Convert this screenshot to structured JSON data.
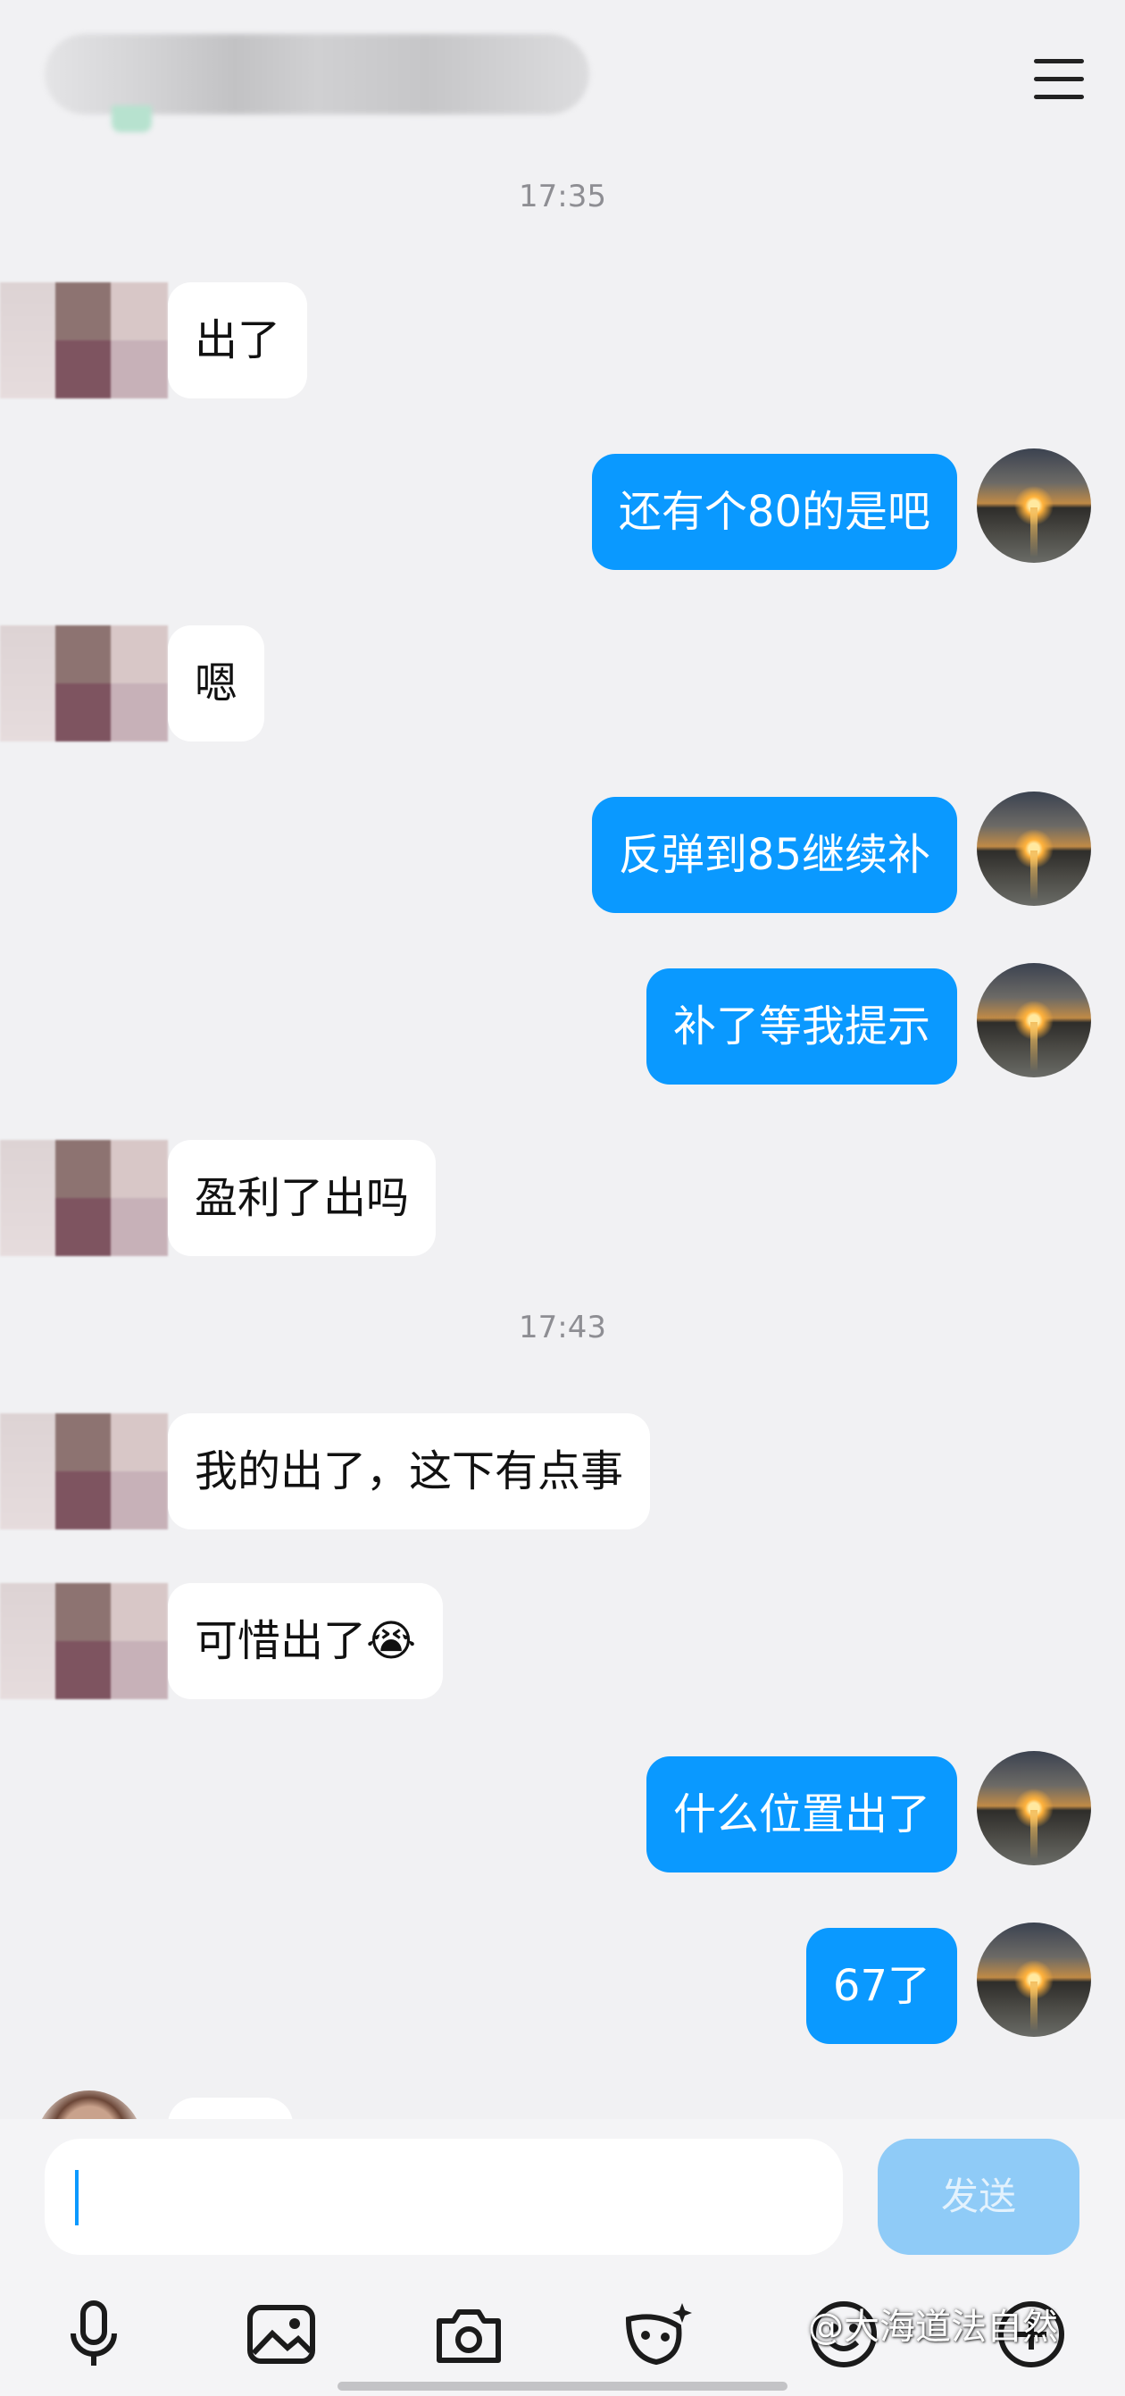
{
  "header": {
    "menu_icon": "hamburger-menu-icon"
  },
  "timestamps": [
    "17:35",
    "17:43"
  ],
  "messages": [
    {
      "side": "in",
      "text": "出了"
    },
    {
      "side": "out",
      "text": "还有个80的是吧"
    },
    {
      "side": "in",
      "text": "嗯"
    },
    {
      "side": "out",
      "text": "反弹到85继续补"
    },
    {
      "side": "out",
      "text": "补了等我提示"
    },
    {
      "side": "in",
      "text": "盈利了出吗"
    },
    {
      "side": "in",
      "text": "我的出了，这下有点事"
    },
    {
      "side": "in",
      "text": "可惜出了😭"
    },
    {
      "side": "out",
      "text": "什么位置出了"
    },
    {
      "side": "out",
      "text": "67了"
    }
  ],
  "composer": {
    "input_value": "",
    "send_label": "发送"
  },
  "toolbar": {
    "icons": [
      "microphone-icon",
      "image-icon",
      "camera-icon",
      "sticker-icon",
      "emoji-icon",
      "add-icon"
    ]
  },
  "watermark": "@大海道法自然",
  "colors": {
    "outgoing_bubble": "#0a99ff",
    "incoming_bubble": "#ffffff",
    "background": "#f1f1f3",
    "send_button_disabled": "#8fcbf7"
  }
}
